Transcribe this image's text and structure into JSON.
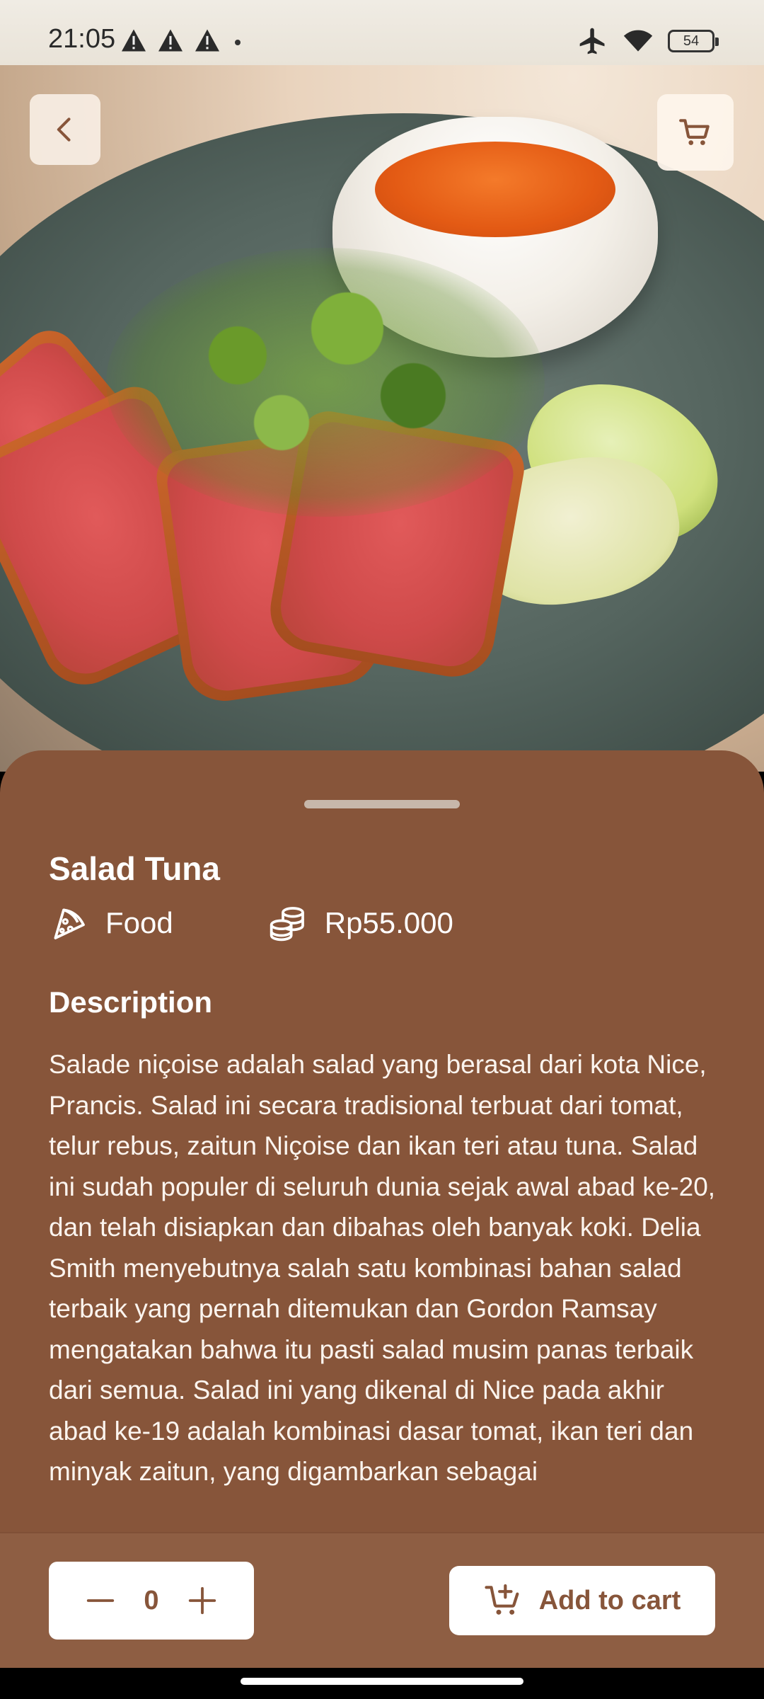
{
  "status_bar": {
    "time": "21:05",
    "battery_level": "54",
    "icons": [
      "warning-icon",
      "warning-icon",
      "warning-icon",
      "airplane-icon",
      "wifi-icon",
      "battery-icon"
    ]
  },
  "top_buttons": {
    "back_icon": "chevron-left-icon",
    "cart_icon": "cart-icon"
  },
  "product": {
    "name": "Salad Tuna",
    "category": "Food",
    "category_icon": "pizza-slice-icon",
    "price": "Rp55.000",
    "price_icon": "coins-icon",
    "description_heading": "Description",
    "description": "Salade niçoise adalah salad yang berasal dari kota Nice, Prancis. Salad ini secara tradisional terbuat dari tomat, telur rebus, zaitun Niçoise dan ikan teri atau tuna. Salad ini sudah populer di seluruh dunia sejak awal abad ke-20, dan telah disiapkan dan dibahas oleh banyak koki. Delia Smith menyebutnya salah satu kombinasi bahan salad terbaik yang pernah ditemukan dan Gordon Ramsay mengatakan bahwa itu pasti salad musim panas terbaik dari semua. Salad ini yang dikenal di Nice pada akhir abad ke-19 adalah kombinasi dasar tomat, ikan teri dan minyak zaitun, yang digambarkan sebagai"
  },
  "actions": {
    "quantity": "0",
    "minus_icon": "minus-icon",
    "plus_icon": "plus-icon",
    "add_to_cart_label": "Add to cart",
    "add_to_cart_icon": "cart-plus-icon"
  },
  "colors": {
    "sheet": "#87553a",
    "action_bar": "#8e5e43",
    "button_bg": "#ffffff"
  }
}
